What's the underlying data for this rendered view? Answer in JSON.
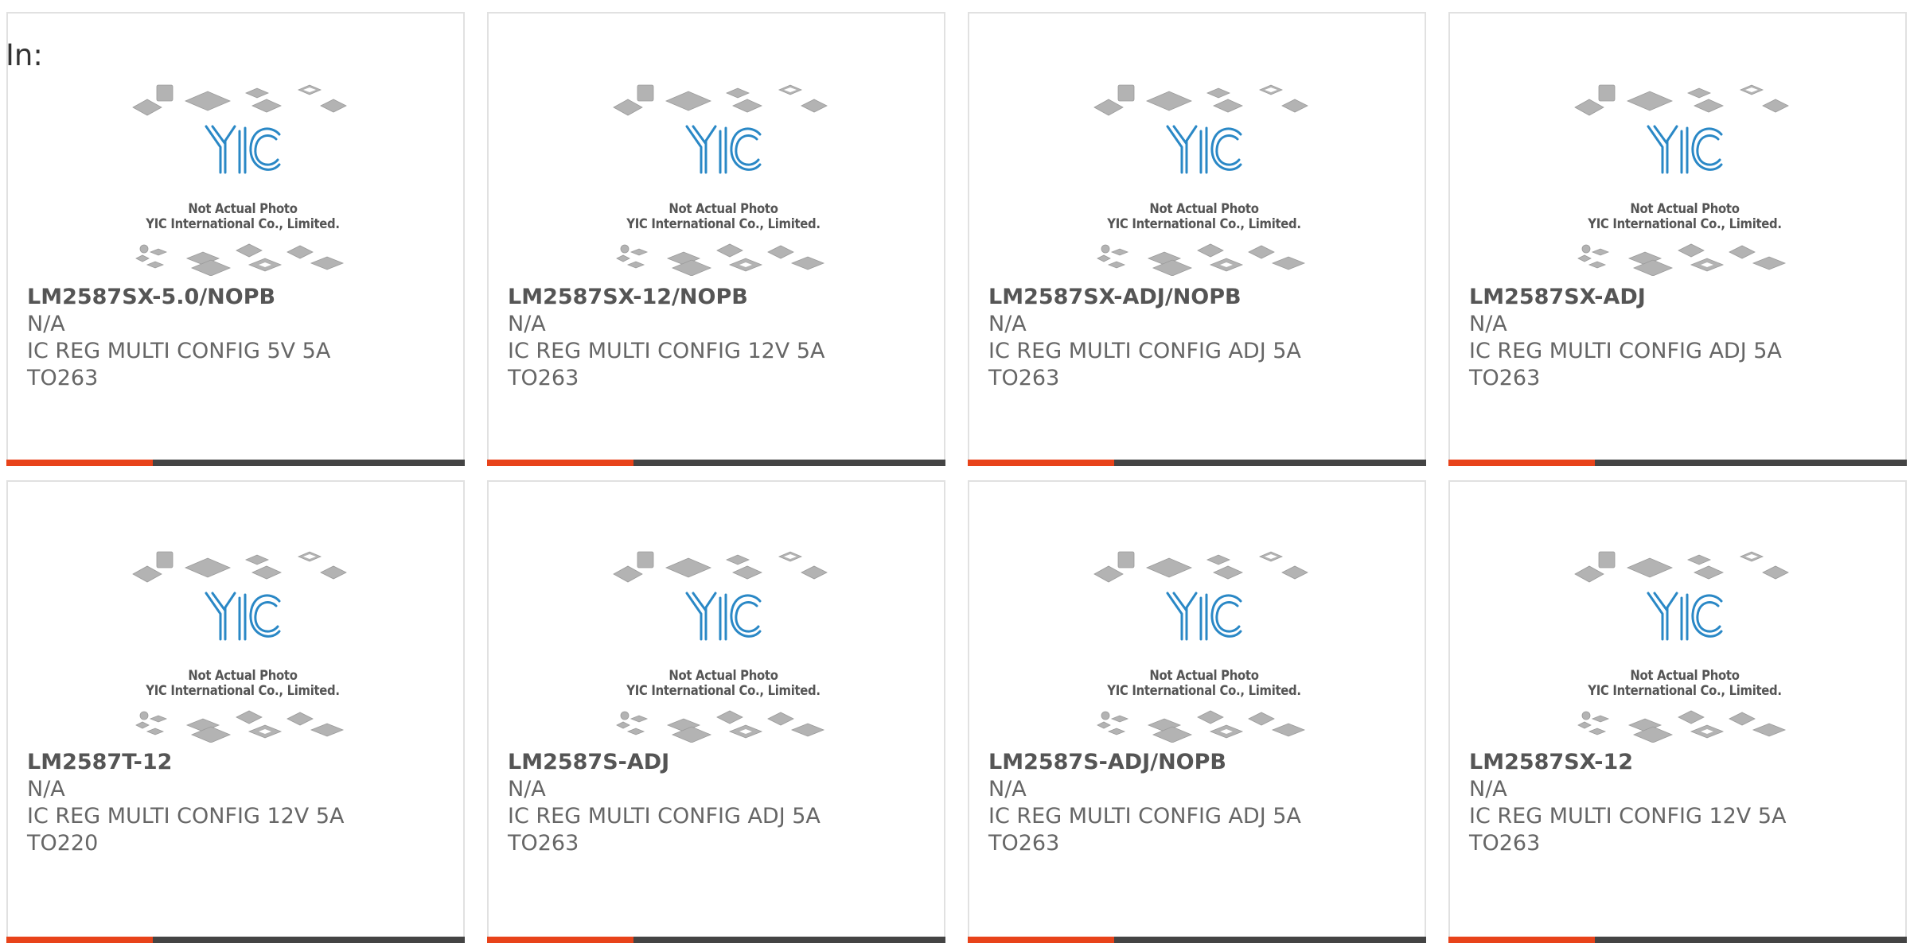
{
  "page": {
    "in_label": "In:",
    "accent_color": "#e8431a",
    "bar_color": "#444444",
    "placeholder": {
      "line1": "Not Actual Photo",
      "line2": "YIC International Co., Limited.",
      "logo_text": "YIC",
      "logo_color": "#2a88c6"
    }
  },
  "products": [
    {
      "part": "LM2587SX-5.0/NOPB",
      "mfr": "N/A",
      "desc1": "IC REG MULTI CONFIG 5V 5A",
      "desc2": "TO263"
    },
    {
      "part": "LM2587SX-12/NOPB",
      "mfr": "N/A",
      "desc1": "IC REG MULTI CONFIG 12V 5A",
      "desc2": "TO263"
    },
    {
      "part": "LM2587SX-ADJ/NOPB",
      "mfr": "N/A",
      "desc1": "IC REG MULTI CONFIG ADJ 5A",
      "desc2": "TO263"
    },
    {
      "part": "LM2587SX-ADJ",
      "mfr": "N/A",
      "desc1": "IC REG MULTI CONFIG ADJ 5A",
      "desc2": "TO263"
    },
    {
      "part": "LM2587T-12",
      "mfr": "N/A",
      "desc1": "IC REG MULTI CONFIG 12V 5A",
      "desc2": "TO220"
    },
    {
      "part": "LM2587S-ADJ",
      "mfr": "N/A",
      "desc1": "IC REG MULTI CONFIG ADJ 5A",
      "desc2": "TO263"
    },
    {
      "part": "LM2587S-ADJ/NOPB",
      "mfr": "N/A",
      "desc1": "IC REG MULTI CONFIG ADJ 5A",
      "desc2": "TO263"
    },
    {
      "part": "LM2587SX-12",
      "mfr": "N/A",
      "desc1": "IC REG MULTI CONFIG 12V 5A",
      "desc2": "TO263"
    }
  ]
}
